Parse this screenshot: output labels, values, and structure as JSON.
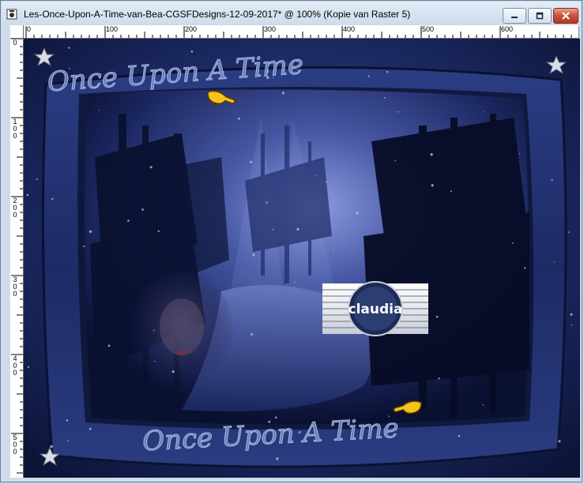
{
  "window": {
    "title": "Les-Once-Upon-A-Time-van-Bea-CGSFDesigns-12-09-2017* @ 100% (Kopie van Raster 5)",
    "buttons": {
      "minimize": "minimize-icon",
      "maximize": "maximize-icon",
      "close": "close-icon"
    }
  },
  "ruler": {
    "top_labels": [
      "0",
      "100",
      "200",
      "300",
      "400",
      "500",
      "600"
    ],
    "left_labels": [
      "0",
      "100",
      "200",
      "300",
      "400",
      "500"
    ]
  },
  "artwork": {
    "wordart_text": "Once Upon A Time",
    "watermark_text": "claudia",
    "colors": {
      "background": "#16204a",
      "frame": "#20306e",
      "scene": "#3a4c8a",
      "wordart": "#6f86c2"
    }
  }
}
